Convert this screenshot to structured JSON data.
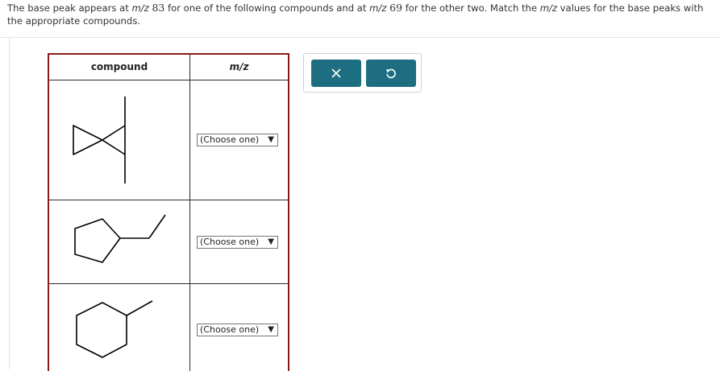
{
  "question": {
    "part1": "The base peak appears at ",
    "mz_a": "m/z",
    "num1": "83",
    "part2": " for one of the following compounds and at ",
    "mz_b": "m/z",
    "num2": "69",
    "part3": " for the other two. Match the ",
    "mz_c": "m/z",
    "part4": " values for the base peaks with the appropriate compounds."
  },
  "table": {
    "header_compound": "compound",
    "header_mz": "m/z",
    "rows": [
      {
        "molecule_icon": "tert-butylmethyl-cyclopropane-structure-icon",
        "select_value": "(Choose one)"
      },
      {
        "molecule_icon": "ethylcyclopentane-structure-icon",
        "select_value": "(Choose one)"
      },
      {
        "molecule_icon": "methylcyclohexane-structure-icon",
        "select_value": "(Choose one)"
      }
    ],
    "select_arrow": "▼",
    "border_color": "#8a1b1b"
  },
  "toolbar": {
    "clear_icon": "close-icon",
    "reset_icon": "undo-icon",
    "button_color": "#1d6e80"
  }
}
